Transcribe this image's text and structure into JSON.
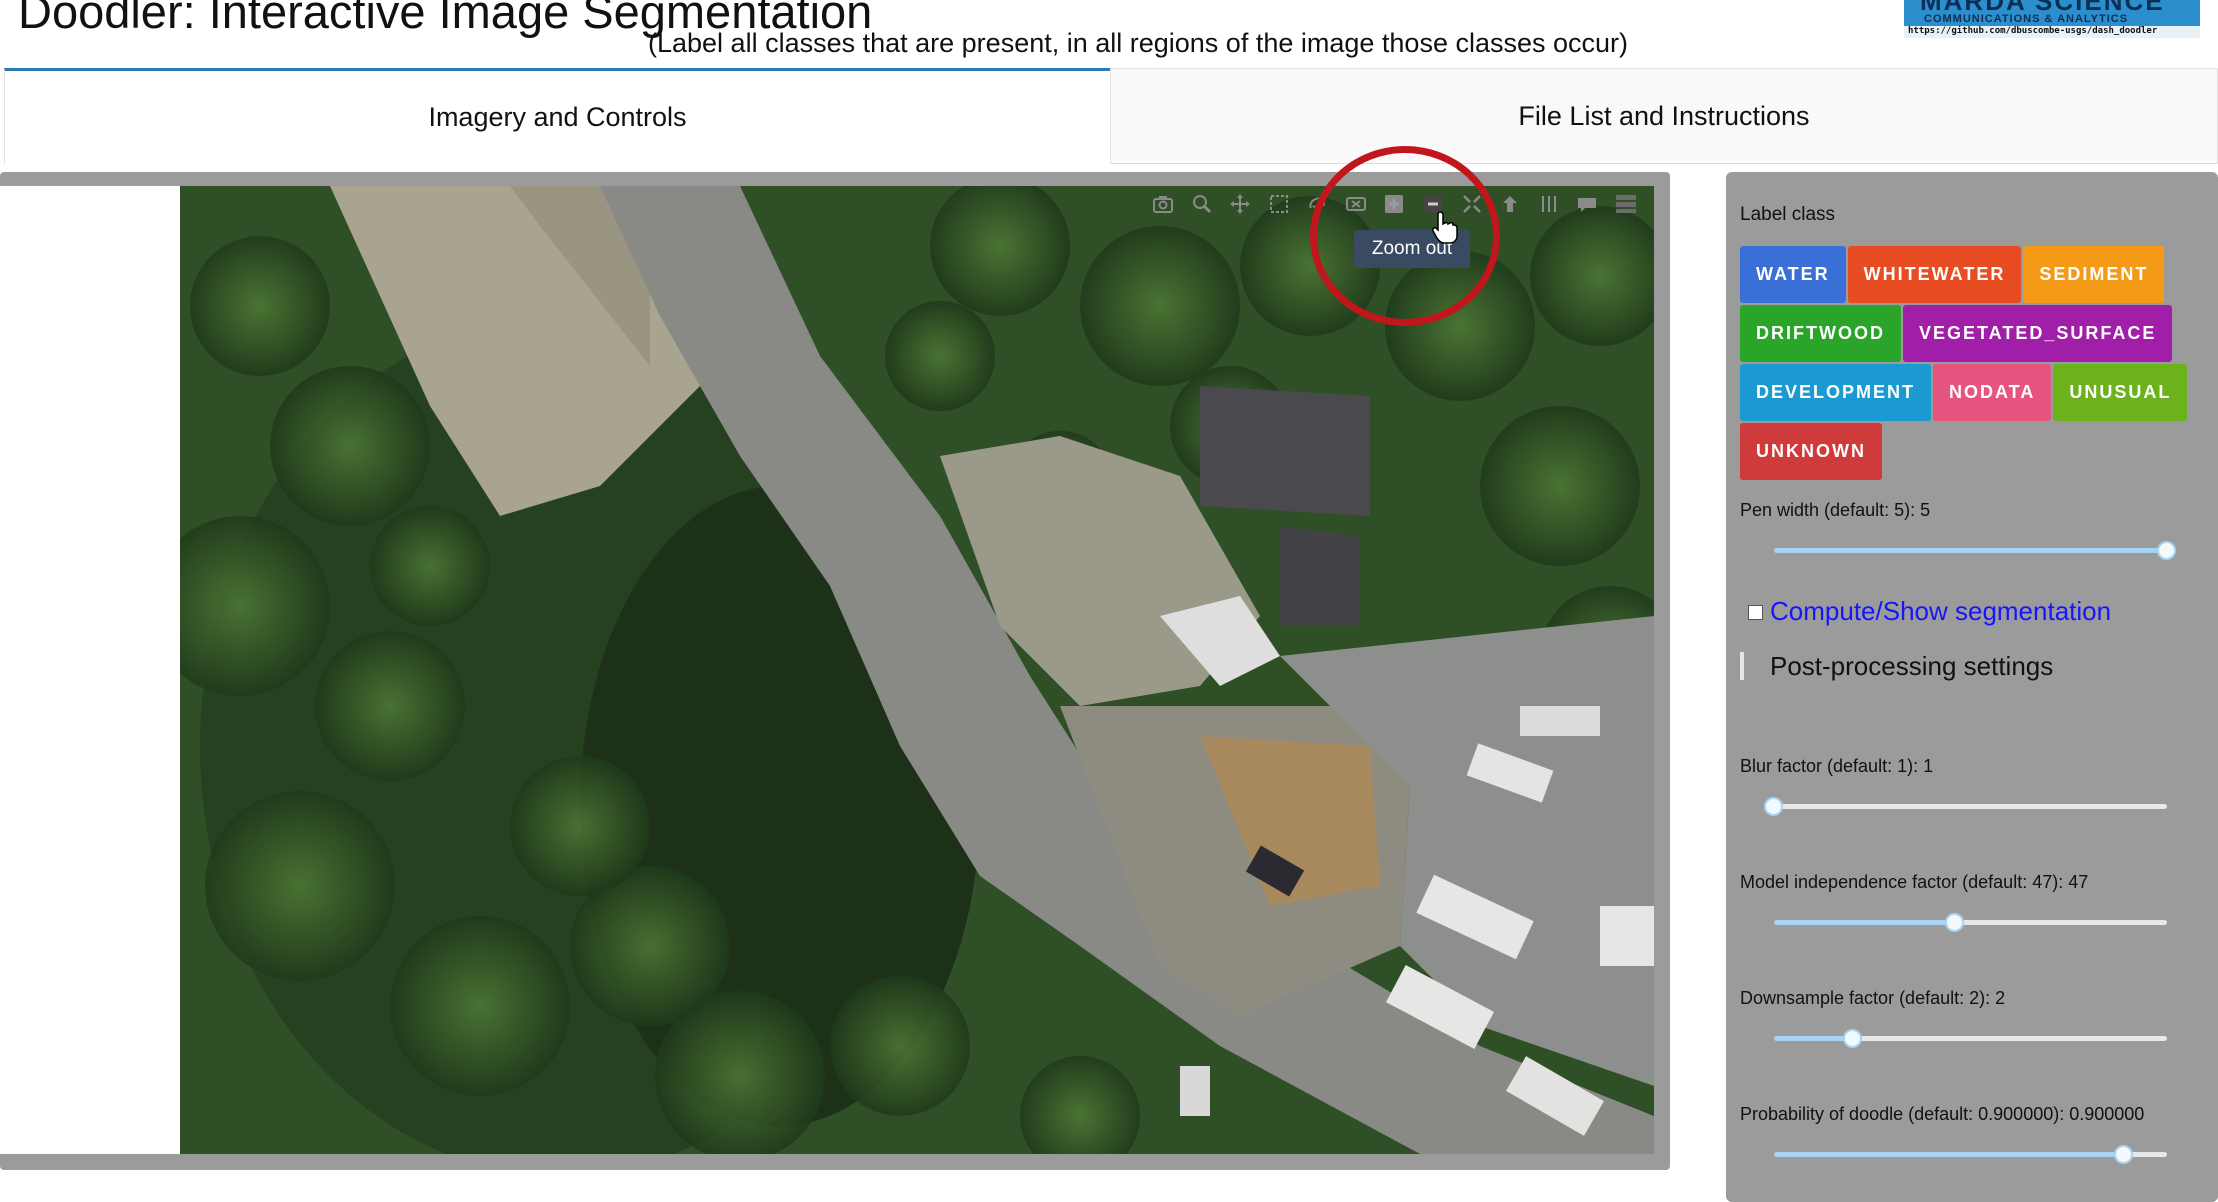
{
  "header": {
    "title": "Doodler: Interactive Image Segmentation",
    "subtitle": "(Label all classes that are present, in all regions of the image those classes occur)",
    "logo_brand": "MARDA SCIENCE",
    "logo_sub": "COMMUNICATIONS & ANALYTICS",
    "logo_url": "https://github.com/dbuscombe-usgs/dash_doodler"
  },
  "tabs": [
    {
      "label": "Imagery and Controls",
      "active": true
    },
    {
      "label": "File List and Instructions",
      "active": false
    }
  ],
  "image_panel": {
    "modebar_icons": [
      "camera-icon",
      "zoom-icon",
      "pan-icon",
      "box-select-icon",
      "lasso-icon",
      "erase-shape-icon",
      "zoom-in-icon",
      "zoom-out-icon",
      "autoscale-icon",
      "reset-axes-icon",
      "spike-lines-icon",
      "hover-closest-icon",
      "plotly-logo-icon"
    ],
    "tooltip": "Zoom out"
  },
  "controls": {
    "label_class_title": "Label class",
    "classes": [
      {
        "label": "WATER",
        "color": "#3b6fd8"
      },
      {
        "label": "WHITEWATER",
        "color": "#e84c22"
      },
      {
        "label": "SEDIMENT",
        "color": "#f59a16"
      },
      {
        "label": "DRIFTWOOD",
        "color": "#2aa52a"
      },
      {
        "label": "VEGETATED_SURFACE",
        "color": "#a11fa8"
      },
      {
        "label": "DEVELOPMENT",
        "color": "#1a9ad0"
      },
      {
        "label": "NODATA",
        "color": "#e5557f"
      },
      {
        "label": "UNUSUAL",
        "color": "#6cb21c"
      },
      {
        "label": "UNKNOWN",
        "color": "#cf3a3a"
      }
    ],
    "pen_width": {
      "label": "Pen width (default: 5): 5",
      "fraction": 1.0
    },
    "segmentation_link": "Compute/Show segmentation",
    "segmentation_checked": false,
    "post_title": "Post-processing settings",
    "blur": {
      "label": "Blur factor (default: 1): 1",
      "fraction": 0.0
    },
    "model_independence": {
      "label": "Model independence factor (default: 47): 47",
      "fraction": 0.46
    },
    "downsample": {
      "label": "Downsample factor (default: 2): 2",
      "fraction": 0.2
    },
    "probability": {
      "label": "Probability of doodle (default: 0.900000): 0.900000",
      "fraction": 0.89
    }
  }
}
